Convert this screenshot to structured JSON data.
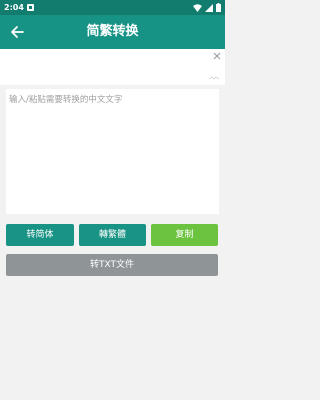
{
  "status_bar": {
    "time": "2:04",
    "icons": [
      "notification-icon",
      "wifi-icon",
      "signal-icon",
      "battery-icon"
    ]
  },
  "toolbar": {
    "title": "简繁转换",
    "back_icon": "arrow-left-icon"
  },
  "ad": {
    "close_icon": "close-icon"
  },
  "input": {
    "placeholder": "输入/粘贴需要转换的中文文字",
    "value": ""
  },
  "actions": {
    "to_simplified": "转简体",
    "to_traditional": "轉繁體",
    "copy": "复制",
    "to_txt": "转TXT文件"
  },
  "colors": {
    "status_bar": "#127c6e",
    "toolbar": "#169384",
    "primary_button": "#199384",
    "copy_button": "#6cc340",
    "txt_button": "#8f9497",
    "background": "#f2f2f2"
  }
}
